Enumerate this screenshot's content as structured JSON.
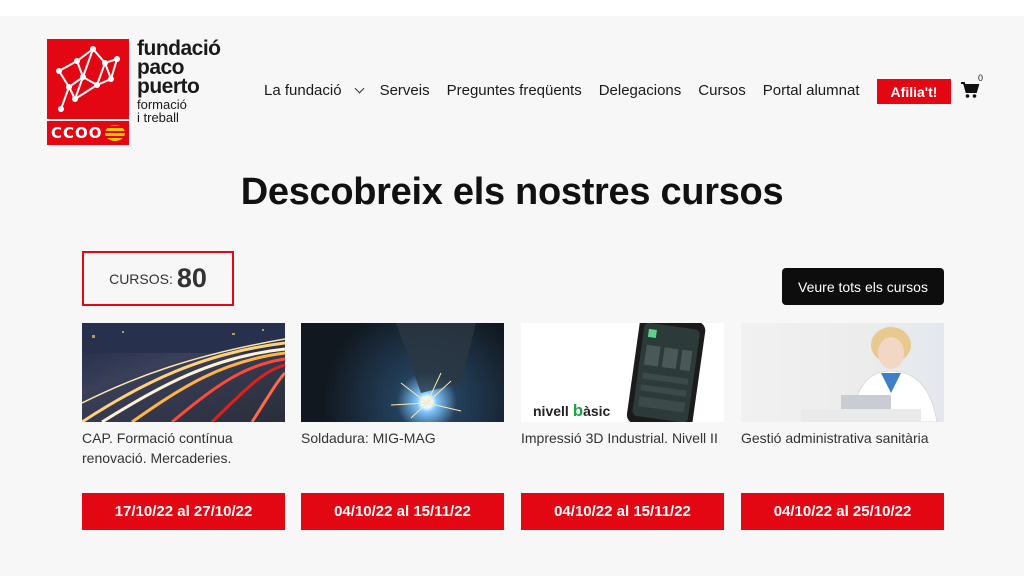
{
  "logo": {
    "line1": "fundació",
    "line2": "paco",
    "line3": "puerto",
    "line4": "formació",
    "line5": "i treball",
    "ccoo": "CCOO"
  },
  "nav": {
    "items": [
      "La fundació",
      "Serveis",
      "Preguntes freqüents",
      "Delegacions",
      "Cursos",
      "Portal alumnat"
    ],
    "afilia": "Afilia't!",
    "cart_count": "0"
  },
  "heading": "Descobreix els nostres cursos",
  "counter": {
    "label": "CURSOS:",
    "value": "80"
  },
  "see_all": "Veure tots els cursos",
  "courses": [
    {
      "title": "CAP. Formació contínua renovació. Mercaderies.",
      "dates": "17/10/22 al 27/10/22",
      "image": "highway-light-trails-image"
    },
    {
      "title": "Soldadura: MIG-MAG",
      "dates": "04/10/22 al 15/11/22",
      "image": "welding-sparks-image"
    },
    {
      "title": "Impressió 3D Industrial. Nivell II",
      "dates": "04/10/22 al 15/11/22",
      "image": "phone-nivell-basic-image",
      "image_text_a": "nivell ",
      "image_text_b": "b",
      "image_text_c": "àsic"
    },
    {
      "title": "Gestió administrativa sanitària",
      "dates": "04/10/22 al 25/10/22",
      "image": "healthcare-worker-laptop-image"
    }
  ],
  "colors": {
    "accent": "#e30613",
    "dark_button": "#0d0d0d",
    "background": "#f7f7f7"
  }
}
